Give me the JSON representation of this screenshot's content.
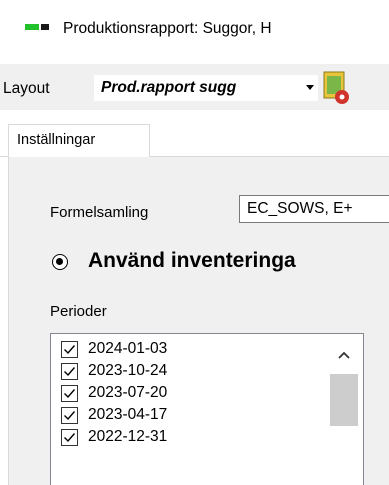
{
  "window": {
    "title": "Produktionsrapport: Suggor, H"
  },
  "toolbar": {
    "layout_label": "Layout",
    "layout_value": "Prod.rapport sugg"
  },
  "tabs": [
    {
      "label": "Inställningar"
    }
  ],
  "settings": {
    "formel_label": "Formelsamling",
    "formel_value": "EC_SOWS, E+",
    "radio_label": "Använd inventeringa",
    "periods_label": "Perioder",
    "periods": [
      {
        "date": "2024-01-03",
        "checked": true
      },
      {
        "date": "2023-10-24",
        "checked": true
      },
      {
        "date": "2023-07-20",
        "checked": true
      },
      {
        "date": "2023-04-17",
        "checked": true
      },
      {
        "date": "2022-12-31",
        "checked": true
      }
    ]
  },
  "icons": {
    "app_logo": "app-logo-icon",
    "toolbar_action": "document-gear-icon",
    "dropdown": "chevron-down-icon",
    "scroll_up": "chevron-up-icon"
  },
  "colors": {
    "logo_green": "#22c02a",
    "panel_bg": "#f0f0f0",
    "scroll_thumb": "#cdcdcd"
  }
}
